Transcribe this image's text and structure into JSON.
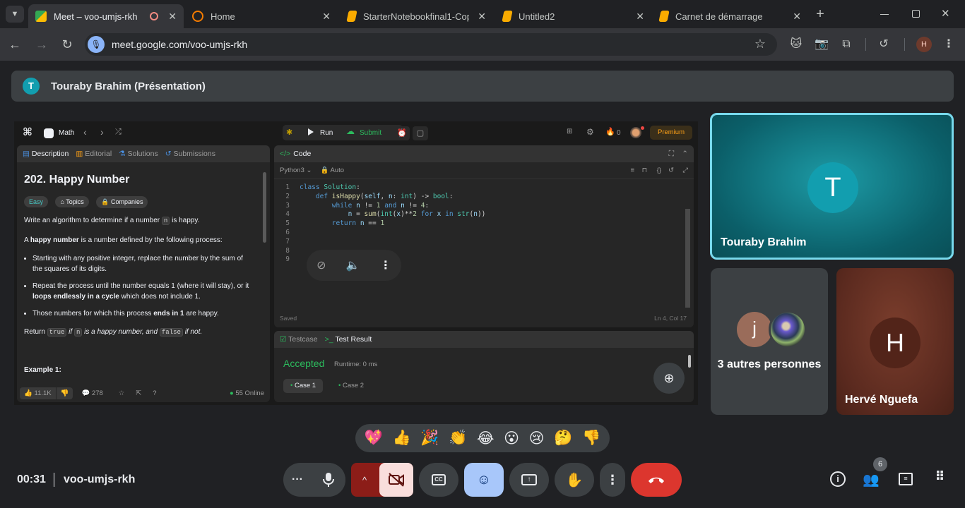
{
  "browser": {
    "tabs": [
      {
        "title": "Meet – voo-umjs-rkh",
        "icon": "meet-icon"
      },
      {
        "title": "Home",
        "icon": "home-icon"
      },
      {
        "title": "StarterNotebookfinal1-Copy",
        "icon": "notebook-icon"
      },
      {
        "title": "Untitled2",
        "icon": "notebook-icon"
      },
      {
        "title": "Carnet de démarrage",
        "icon": "notebook-icon"
      }
    ],
    "new_tab": "+",
    "url": "meet.google.com/voo-umjs-rkh",
    "profile_initial": "H"
  },
  "presenter": {
    "initial": "T",
    "label": "Touraby Brahim (Présentation)"
  },
  "shared_screen": {
    "topbar": {
      "problem_list": "Math",
      "run": "Run",
      "submit": "Submit",
      "streak": "0",
      "premium": "Premium"
    },
    "description_tabs": [
      "Description",
      "Editorial",
      "Solutions",
      "Submissions"
    ],
    "problem": {
      "title": "202. Happy Number",
      "difficulty": "Easy",
      "topics": "Topics",
      "companies": "Companies",
      "intro_before": "Write an algorithm to determine if a number ",
      "intro_code": "n",
      "intro_after": " is happy.",
      "def_a": "A ",
      "def_bold": "happy number",
      "def_rest": " is a number defined by the following process:",
      "bullet1": "Starting with any positive integer, replace the number by the sum of the squares of its digits.",
      "bullet2_a": "Repeat the process until the number equals 1 (where it will stay), or it ",
      "bullet2_bold": "loops endlessly in a cycle",
      "bullet2_b": " which does not include 1.",
      "bullet3_a": "Those numbers for which this process ",
      "bullet3_bold": "ends in 1",
      "bullet3_b": " are happy.",
      "return_a": "Return ",
      "return_true": "true",
      "return_b": " if ",
      "return_n": "n",
      "return_c": " is a happy number, and ",
      "return_false": "false",
      "return_d": " if not.",
      "example": "Example 1:",
      "likes": "11.1K",
      "comments": "278",
      "online": "55 Online"
    },
    "code_panel": {
      "title": "Code",
      "language": "Python3",
      "auto": "Auto",
      "saved": "Saved",
      "cursor": "Ln 4, Col 17",
      "lines": [
        "1",
        "2",
        "3",
        "4",
        "5",
        "6",
        "7",
        "8",
        "9"
      ]
    },
    "test_panel": {
      "tab_testcase": "Testcase",
      "tab_result": "Test Result",
      "status": "Accepted",
      "runtime": "Runtime: 0 ms",
      "case1": "Case 1",
      "case2": "Case 2"
    }
  },
  "participants": {
    "main": {
      "initial": "T",
      "name": "Touraby Brahim"
    },
    "others": {
      "initial": "j",
      "label": "3 autres personnes"
    },
    "third": {
      "initial": "H",
      "name": "Hervé Nguefa"
    }
  },
  "reactions": [
    "💖",
    "👍",
    "🎉",
    "👏",
    "😂",
    "😮",
    "😢",
    "🤔",
    "👎"
  ],
  "meeting": {
    "time": "00:31",
    "code": "voo-umjs-rkh",
    "participant_count": "6"
  },
  "colors": {
    "accent_teal": "#129eaf",
    "accepted_green": "#2cbb5d",
    "end_call_red": "#ea4335",
    "active_tile_border": "#78d9ec"
  }
}
